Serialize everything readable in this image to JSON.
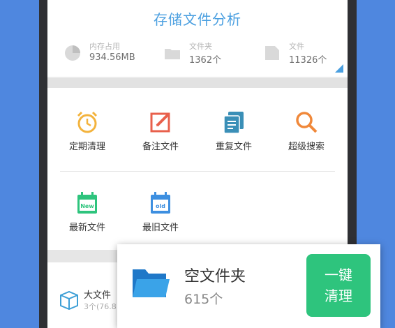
{
  "header": {
    "title": "存储文件分析"
  },
  "stats": [
    {
      "label": "内存占用",
      "value": "934.56MB",
      "icon": "pie-chart-icon"
    },
    {
      "label": "文件夹",
      "value": "1362个",
      "icon": "folder-icon"
    },
    {
      "label": "文件",
      "value": "11326个",
      "icon": "file-icon"
    }
  ],
  "tools": [
    {
      "label": "定期清理",
      "icon": "alarm-clock-icon"
    },
    {
      "label": "备注文件",
      "icon": "edit-note-icon"
    },
    {
      "label": "重复文件",
      "icon": "duplicate-file-icon"
    },
    {
      "label": "超级搜索",
      "icon": "search-icon"
    },
    {
      "label": "最新文件",
      "icon": "calendar-new-icon",
      "badge": "New"
    },
    {
      "label": "最旧文件",
      "icon": "calendar-old-icon",
      "badge": "old"
    }
  ],
  "list": {
    "big_files_name": "大文件",
    "big_files_sub": "3个(76.8"
  },
  "popup": {
    "name": "空文件夹",
    "count": "615个",
    "button_line1": "一键",
    "button_line2": "清理"
  },
  "colors": {
    "accent": "#4a9fe0",
    "green": "#2ec47d",
    "background": "#4f87df"
  }
}
